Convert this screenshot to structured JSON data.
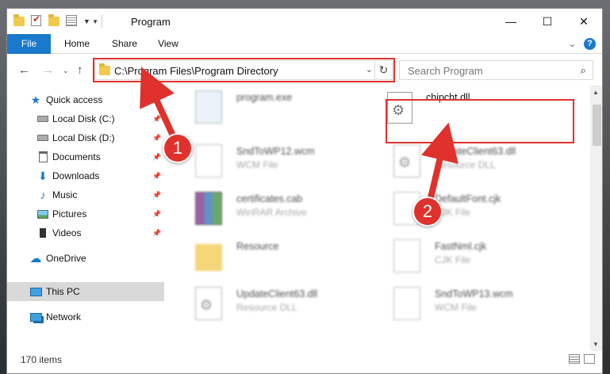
{
  "window": {
    "title": "Program",
    "controls": {
      "minimize": "—",
      "maximize": "☐",
      "close": "✕"
    }
  },
  "ribbon": {
    "tabs": [
      "File",
      "Home",
      "Share",
      "View"
    ],
    "collapse_icon": "chevron-up",
    "help_label": "?"
  },
  "address": {
    "path": "C:\\Program Files\\Program Directory",
    "highlight_color": "#e0312c"
  },
  "search": {
    "placeholder": "Search Program"
  },
  "sidebar": {
    "items": [
      {
        "label": "Quick access",
        "icon": "star-icon"
      },
      {
        "label": "Local Disk (C:)",
        "icon": "drive-icon",
        "pinned": true
      },
      {
        "label": "Local Disk (D:)",
        "icon": "drive-icon",
        "pinned": true
      },
      {
        "label": "Documents",
        "icon": "documents-icon",
        "pinned": true
      },
      {
        "label": "Downloads",
        "icon": "downloads-icon",
        "pinned": true
      },
      {
        "label": "Music",
        "icon": "music-icon",
        "pinned": true
      },
      {
        "label": "Pictures",
        "icon": "pictures-icon",
        "pinned": true
      },
      {
        "label": "Videos",
        "icon": "videos-icon",
        "pinned": true
      },
      {
        "label": "OneDrive",
        "icon": "onedrive-icon"
      },
      {
        "label": "This PC",
        "icon": "this-pc-icon",
        "selected": true
      },
      {
        "label": "Network",
        "icon": "network-icon"
      }
    ]
  },
  "files": [
    {
      "name": "program.exe",
      "type": ""
    },
    {
      "name": "chipcht.dll",
      "type": ""
    },
    {
      "name": "SndToWP12.wcm",
      "type": "WCM File"
    },
    {
      "name": "UpdateClient63.dll",
      "type": "Resource DLL"
    },
    {
      "name": "certificates.cab",
      "type": "WinRAR Archive"
    },
    {
      "name": "DefaultFont.cjk",
      "type": "CJK File"
    },
    {
      "name": "Resource",
      "type": ""
    },
    {
      "name": "FastNml.cjk",
      "type": "CJK File"
    },
    {
      "name": "UpdateClient63.dll",
      "type": "Resource DLL"
    },
    {
      "name": "SndToWP13.wcm",
      "type": "WCM File"
    }
  ],
  "status": {
    "item_count": "170 items"
  },
  "steps": {
    "one": "1",
    "two": "2",
    "arrow_color": "#e0312c"
  }
}
